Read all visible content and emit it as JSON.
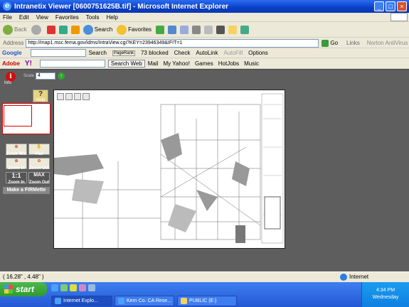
{
  "window": {
    "title": "Intranetix Viewer [0600751625B.tif] - Microsoft Internet Explorer"
  },
  "menu": [
    "File",
    "Edit",
    "View",
    "Favorites",
    "Tools",
    "Help"
  ],
  "toolbar": {
    "back": "Back",
    "search": "Search",
    "favorites": "Favorites"
  },
  "address": {
    "label": "Address",
    "url": "http://map1.msc.fema.gov/idms/IntraView.cgi?KEY=23946349&IFIT=1",
    "go": "Go",
    "links": "Links",
    "norton": "Norton AntiVirus"
  },
  "google_bar": {
    "label": "Google",
    "search": "Search",
    "pagerank": "PageRank",
    "blocked": "73 blocked",
    "check": "Check",
    "autolink": "AutoLink",
    "autofill": "AutoFill",
    "options": "Options"
  },
  "yahoo_bar": {
    "adobe": "Adobe",
    "yahoo": "Y!",
    "search_web": "Search Web",
    "mail": "Mail",
    "my_yahoo": "My Yahoo!",
    "games": "Games",
    "hotjobs": "HotJobs",
    "music": "Music"
  },
  "viewer": {
    "info": "Info",
    "scale_label": "Scale",
    "scale_value": "4",
    "help": "Help",
    "tools": [
      {
        "label": "Zoom Win"
      },
      {
        "label": "Pan"
      },
      {
        "label": "Zoom In"
      },
      {
        "label": "Zoom Out"
      },
      {
        "label": "1:1",
        "sub": "Zoom In"
      },
      {
        "label": "MAX",
        "sub": "Zoom Out"
      }
    ],
    "firmette": "Make a FIRMette"
  },
  "status": {
    "coords": "( 16.28\" , 4.48\" )",
    "zone": "Internet"
  },
  "taskbar": {
    "start": "start",
    "tasks": [
      "Internet Explo...",
      "Kern Co. CA Rese...",
      "PUBLIC (E:)"
    ],
    "clock": "4:34 PM",
    "day": "Wednesday"
  }
}
